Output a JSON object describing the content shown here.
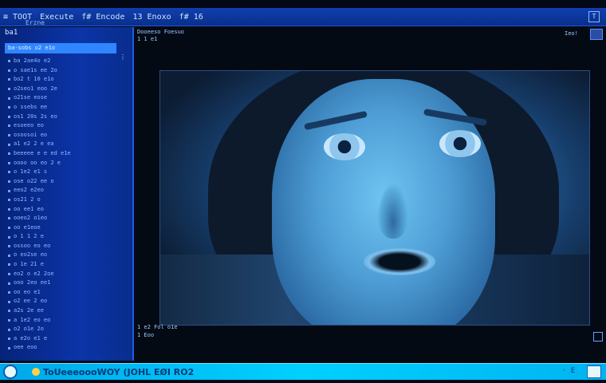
{
  "titlebar": {
    "items": [
      "≡ TOOT",
      "Execute",
      "f# Encode",
      "13 Enoxo",
      "f# 16"
    ],
    "sub": "Erzne",
    "ctrl": "T"
  },
  "sidebar": {
    "header": "ba1",
    "selected": "ba-sobs o2 e1o",
    "items": [
      "ba 2ae4o e2",
      "o sae1s ee 2o",
      "bo2 t 10 e1o",
      "o2seo1 eoo 2e",
      "o21se eose",
      "o ssebs ee",
      "os1 20s 2s eo",
      "esoeeo eo",
      "osoosoi eo",
      "a1 e2 2 e ea",
      "beeeee e e ed e1e",
      "oooo oo eo 2 e",
      "o 1e2 e1 s",
      "ose o22 ee o",
      "eeo2 e2eo",
      "os21 2 o",
      "oo ee1 eo",
      "ooeo2 o1eo",
      "oo e1eoe",
      "o 1 1 2 e",
      "ossoo eo eo",
      "o eo2se eo",
      "o 1e 21 e",
      "eo2 o e2 2oe",
      "ooo 2eo ee1",
      "oo eo e1",
      "o2 ee 2 eo",
      "a2s 2e ee",
      "a 1e2 eo eo",
      "o2 o1e 2o",
      "a e2o e1 e",
      "oee eoo"
    ]
  },
  "viewer": {
    "top_label": "Dooeeso Foesuo",
    "top_label2": "1 1 e1",
    "top_right": "Ieo!",
    "bot_label": "1 e2 Fol o1e",
    "bot_label2": "1 Eoo",
    "image_desc": "video-frame"
  },
  "taskbar": {
    "text": "ToUeeeoooWOY (JOHL EØI RO2",
    "tray": "· E  "
  }
}
